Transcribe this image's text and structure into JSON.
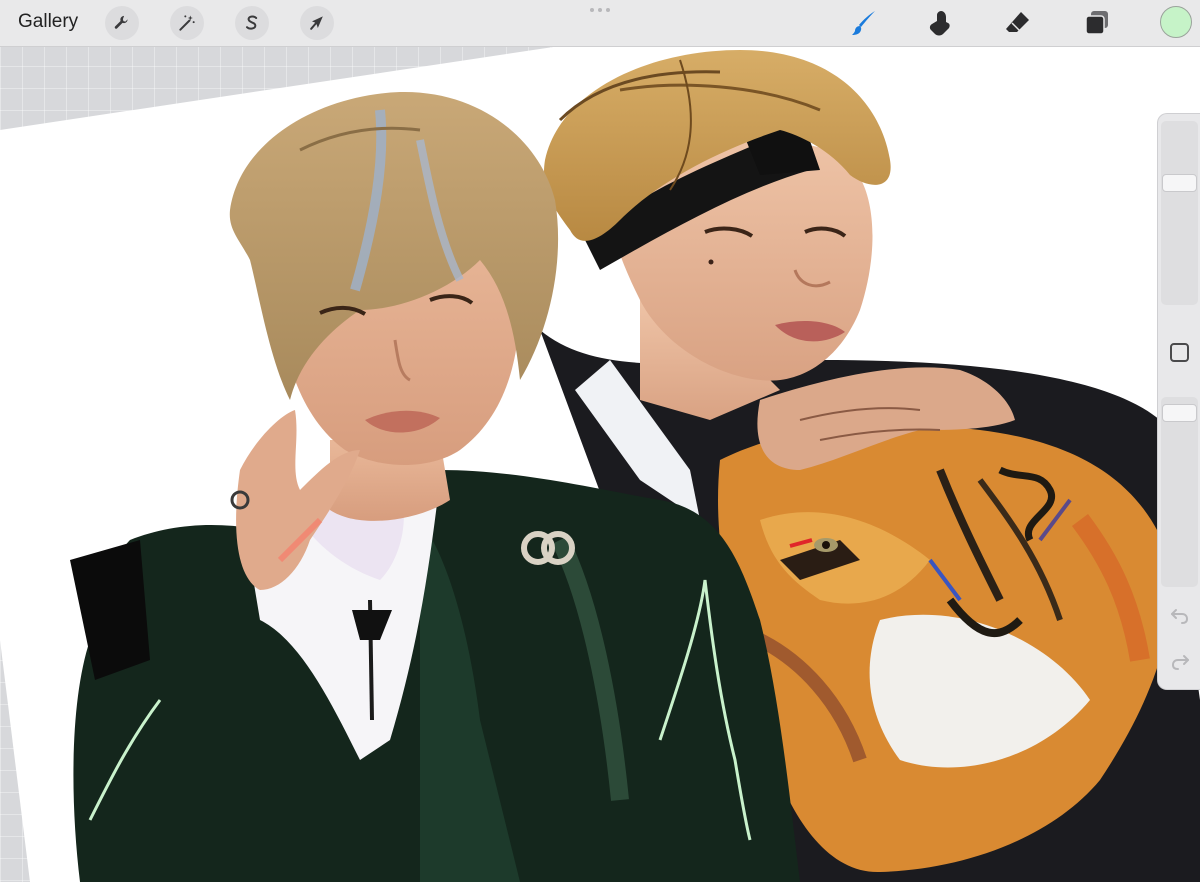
{
  "toolbar": {
    "gallery_label": "Gallery",
    "left_tools": [
      {
        "icon": "wrench-icon",
        "name": "actions"
      },
      {
        "icon": "magic-wand-icon",
        "name": "adjustments"
      },
      {
        "icon": "selection-s-icon",
        "name": "selection"
      },
      {
        "icon": "arrow-cursor-icon",
        "name": "transform"
      }
    ],
    "right_tools": [
      {
        "icon": "brush-icon",
        "name": "paint",
        "active": true
      },
      {
        "icon": "smudge-icon",
        "name": "smudge"
      },
      {
        "icon": "eraser-icon",
        "name": "erase"
      },
      {
        "icon": "layers-icon",
        "name": "layers"
      }
    ],
    "current_color": "#c6f3c8",
    "active_color": "#1a7bdc"
  },
  "sidebar": {
    "brush_size_level": 0.32,
    "opacity_level": 0.04,
    "modify_icon": "square-modify-icon",
    "undo_icon": "undo-arrow-icon",
    "redo_icon": "redo-arrow-icon"
  }
}
